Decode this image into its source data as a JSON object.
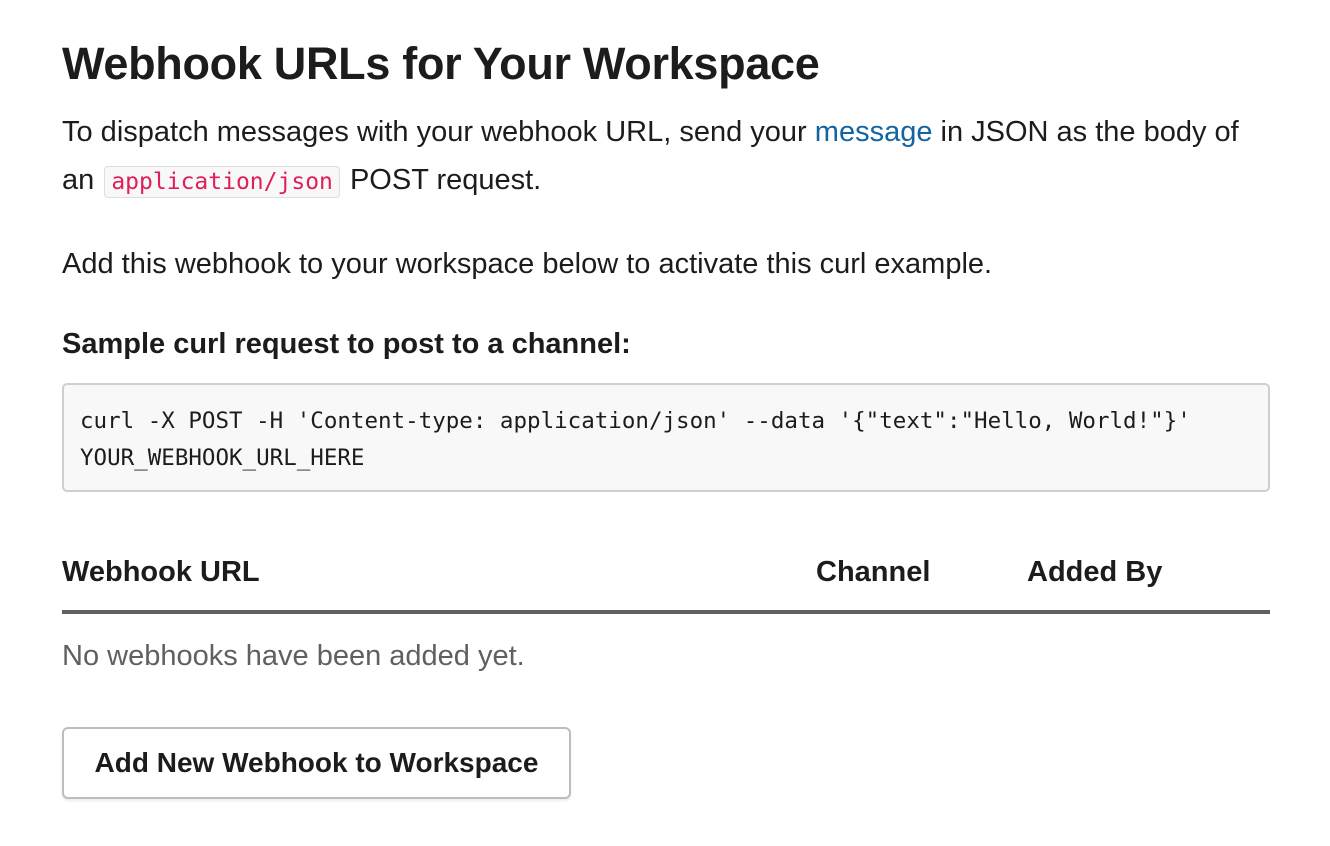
{
  "page": {
    "title": "Webhook URLs for Your Workspace",
    "intro": {
      "text_before_link": "To dispatch messages with your webhook URL, send your ",
      "link_label": "message",
      "text_after_link": " in JSON as the body of an ",
      "inline_code": "application/json",
      "text_end": " POST request."
    },
    "activate_note": "Add this webhook to your workspace below to activate this curl example.",
    "sample_heading": "Sample curl request to post to a channel:",
    "sample_code": "curl -X POST -H 'Content-type: application/json' --data '{\"text\":\"Hello, World!\"}' YOUR_WEBHOOK_URL_HERE"
  },
  "webhooks_table": {
    "columns": [
      "Webhook URL",
      "Channel",
      "Added By"
    ],
    "empty_message": "No webhooks have been added yet."
  },
  "add_button": {
    "label": "Add New Webhook to Workspace"
  },
  "colors": {
    "link": "#1264a3",
    "inline_code_text": "#e01e5a",
    "code_background": "#f8f8f8",
    "muted_text": "#616061"
  }
}
